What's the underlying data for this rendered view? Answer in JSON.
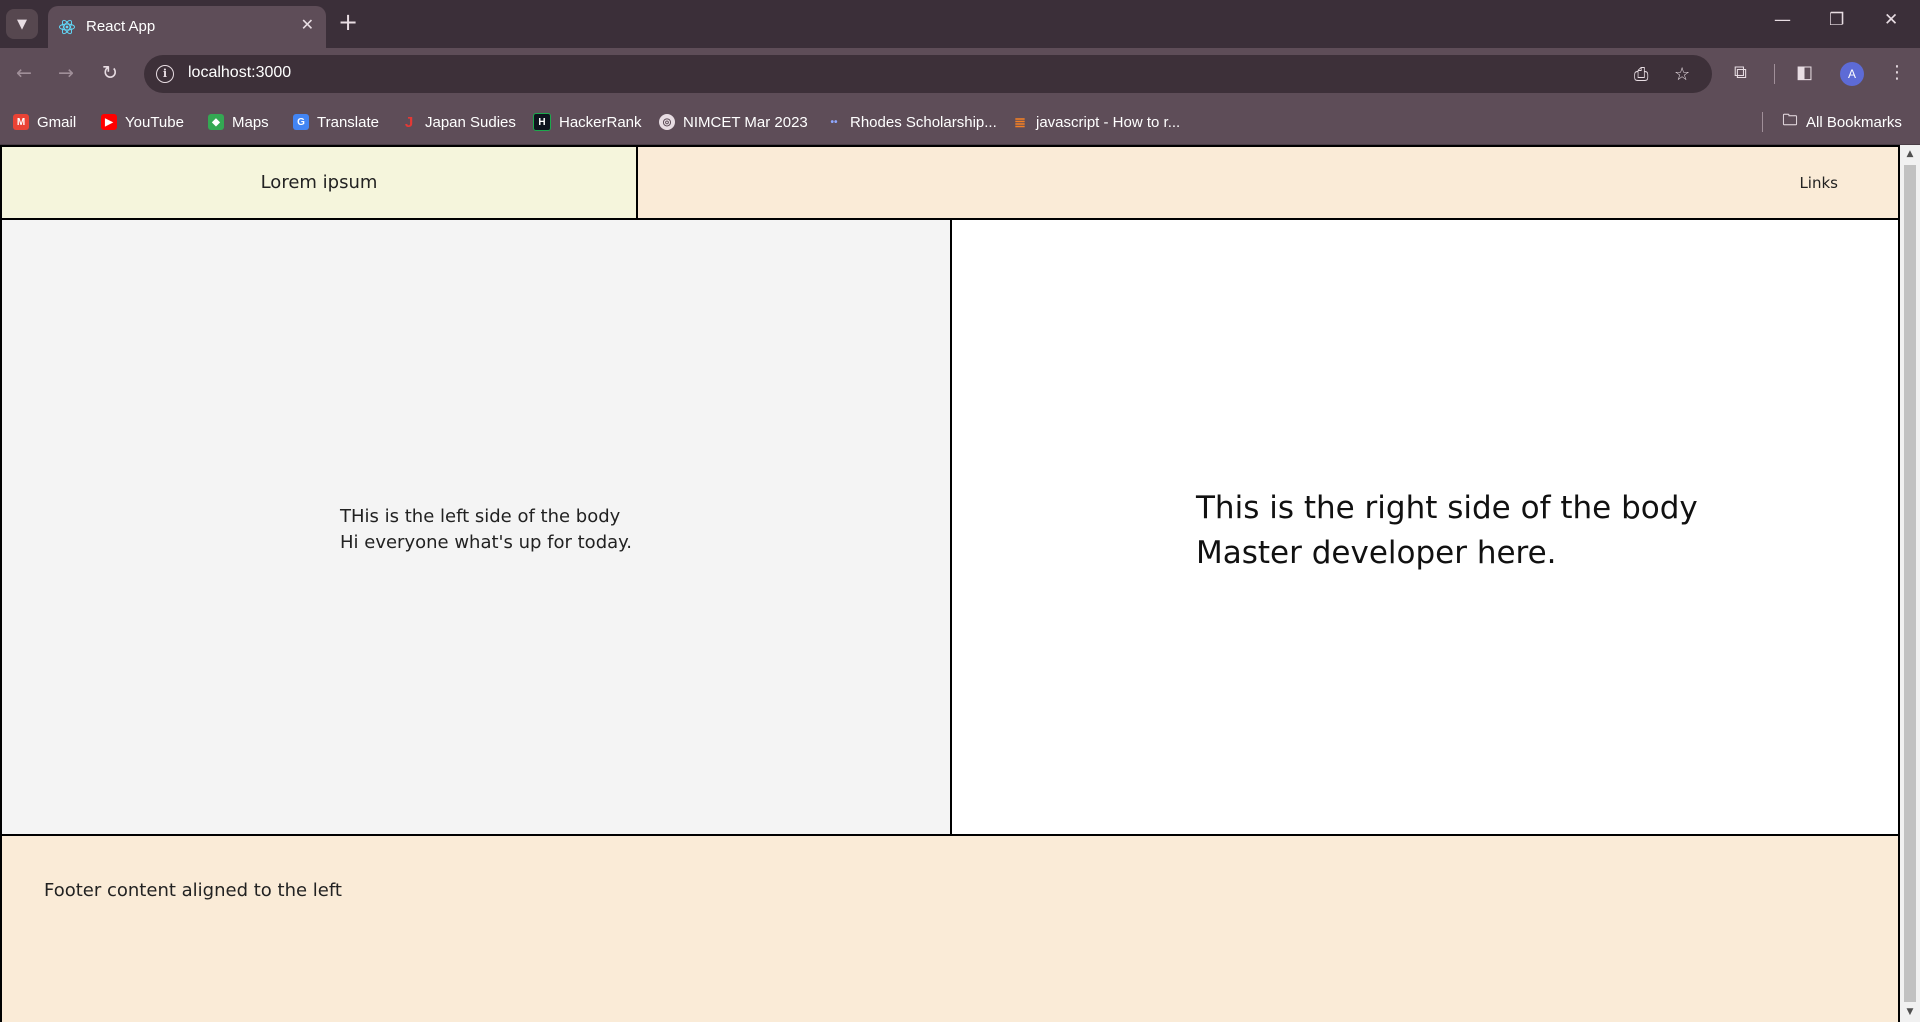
{
  "browser": {
    "tab": {
      "title": "React App"
    },
    "address": {
      "url": "localhost:3000"
    },
    "profile_initial": "A",
    "bookmarks": [
      {
        "label": "Gmail",
        "icon": "gmail-icon"
      },
      {
        "label": "YouTube",
        "icon": "youtube-icon"
      },
      {
        "label": "Maps",
        "icon": "maps-icon"
      },
      {
        "label": "Translate",
        "icon": "translate-icon"
      },
      {
        "label": "Japan Sudies",
        "icon": "japan-studies-icon"
      },
      {
        "label": "HackerRank",
        "icon": "hackerrank-icon"
      },
      {
        "label": "NIMCET Mar 2023",
        "icon": "globe-icon"
      },
      {
        "label": "Rhodes Scholarship...",
        "icon": "rhodes-icon"
      },
      {
        "label": "javascript - How to r...",
        "icon": "stackoverflow-icon"
      }
    ],
    "all_bookmarks": "All Bookmarks"
  },
  "page": {
    "header": {
      "title": "Lorem ipsum",
      "links": "Links"
    },
    "left": {
      "line1": "THis is the left side of the body",
      "line2": "Hi everyone what's up for today."
    },
    "right": {
      "line1": "This is the right side of the body",
      "line2": "Master developer here."
    },
    "footer": {
      "text": "Footer content aligned to the left"
    }
  },
  "colors": {
    "header_left_bg": "#f5f5dc",
    "header_right_bg": "#faebd7",
    "body_left_bg": "#f4f4f4",
    "footer_bg": "#faebd7",
    "chrome_dark": "#3b2f39",
    "chrome_light": "#5e4d58"
  }
}
